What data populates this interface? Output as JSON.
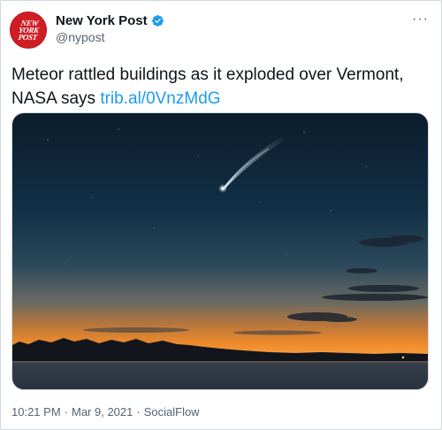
{
  "author": {
    "display_name": "New York Post",
    "handle": "@nypost",
    "avatar_lines": [
      "NEW",
      "YORK",
      "POST"
    ],
    "verified_icon": "verified-badge-icon",
    "brand_color": "#d01d24"
  },
  "more_button": {
    "icon": "more-horizontal-icon",
    "label": "···"
  },
  "tweet": {
    "text": "Meteor rattled buildings as it exploded over Vermont, NASA says ",
    "link": "trib.al/0VnzMdG",
    "link_color": "#1d9bf0"
  },
  "media": {
    "description_icon": "photo"
  },
  "meta": {
    "time": "10:21 PM",
    "separator": "·",
    "date": "Mar 9, 2021",
    "source": "SocialFlow"
  }
}
